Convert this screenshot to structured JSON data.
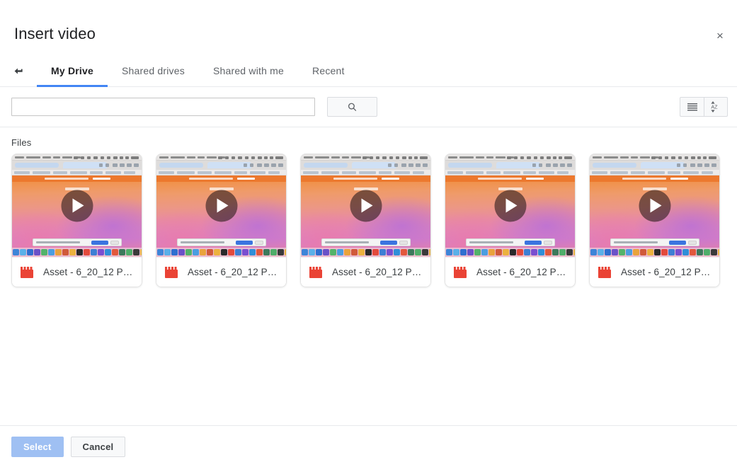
{
  "dialog": {
    "title": "Insert video",
    "close_label": "×",
    "close_icon": "close-icon"
  },
  "nav": {
    "back_icon": "back-arrow-icon",
    "tabs": [
      {
        "label": "My Drive",
        "active": true
      },
      {
        "label": "Shared drives",
        "active": false
      },
      {
        "label": "Shared with me",
        "active": false
      },
      {
        "label": "Recent",
        "active": false
      }
    ]
  },
  "search": {
    "value": "",
    "placeholder": "",
    "button_icon": "search-icon"
  },
  "view_controls": [
    {
      "icon": "list-view-icon",
      "active": true
    },
    {
      "icon": "sort-az-icon",
      "active": false
    }
  ],
  "main": {
    "section_label": "Files",
    "files": [
      {
        "name": "Asset - 6_20_12 P…",
        "icon": "video-file-icon",
        "play_icon": "play-icon"
      },
      {
        "name": "Asset - 6_20_12 P…",
        "icon": "video-file-icon",
        "play_icon": "play-icon"
      },
      {
        "name": "Asset - 6_20_12 P…",
        "icon": "video-file-icon",
        "play_icon": "play-icon"
      },
      {
        "name": "Asset - 6_20_12 P…",
        "icon": "video-file-icon",
        "play_icon": "play-icon"
      },
      {
        "name": "Asset - 6_20_12 P…",
        "icon": "video-file-icon",
        "play_icon": "play-icon"
      }
    ]
  },
  "footer": {
    "select_label": "Select",
    "select_disabled": true,
    "cancel_label": "Cancel"
  },
  "colors": {
    "accent": "#4285f4",
    "primary_button_disabled": "#9fc0f3",
    "video_icon_red": "#ea4335",
    "text_primary": "#202124",
    "text_secondary": "#5f6368",
    "border": "#e8eaed"
  },
  "thumbnail_dock_colors": [
    "#3d85d8",
    "#5ab0e8",
    "#2f6fd0",
    "#6a52c8",
    "#52b36a",
    "#4b9ee0",
    "#e9a33c",
    "#d05a3a",
    "#ecb23e",
    "#2a2a2a",
    "#e34a3c",
    "#3d7fd4",
    "#7a4fd0",
    "#2f8fd8",
    "#e2583c",
    "#3c7a5c",
    "#4fae6a",
    "#3a3a3a",
    "#e8b13c",
    "#3f8fd0",
    "#d84a3c",
    "#e6e6e6",
    "#b5b5b5",
    "#4fa2d8"
  ]
}
